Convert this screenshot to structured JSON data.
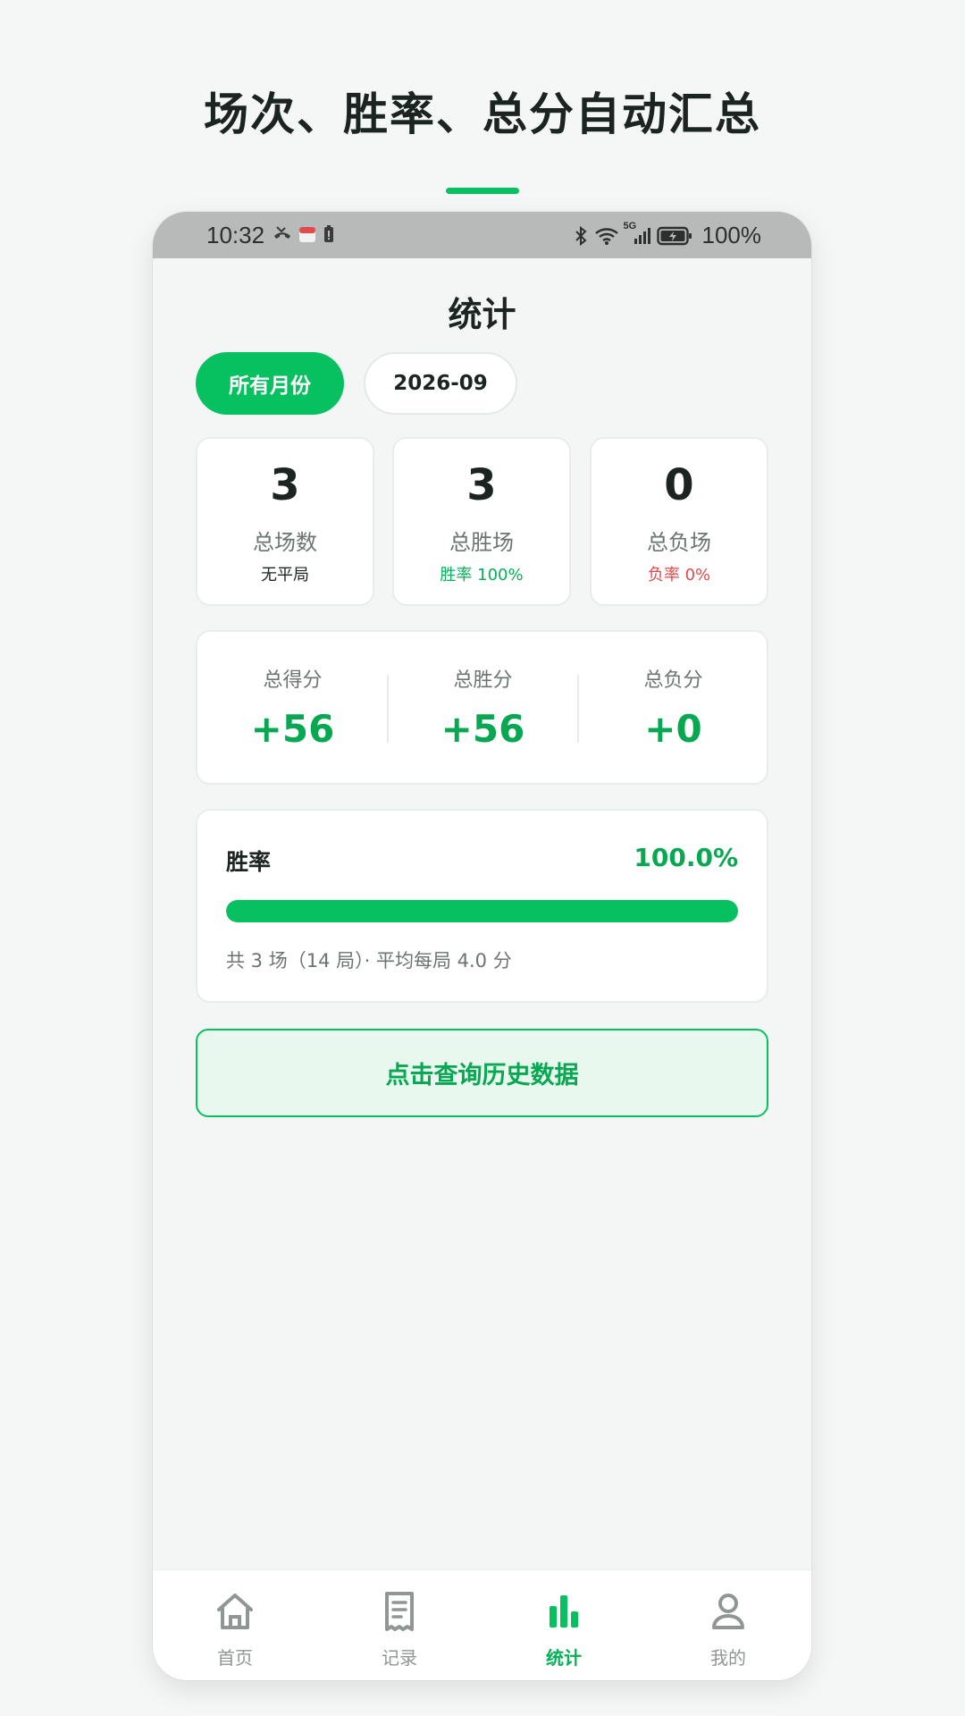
{
  "headline": "场次、胜率、总分自动汇总",
  "status_bar": {
    "time": "10:32",
    "signal_label": "5G",
    "battery": "100%"
  },
  "page": {
    "title": "统计"
  },
  "filters": {
    "all_months": "所有月份",
    "month": "2026-09"
  },
  "summary": {
    "total": {
      "value": "3",
      "label": "总场数",
      "sub": "无平局"
    },
    "wins": {
      "value": "3",
      "label": "总胜场",
      "sub": "胜率 100%"
    },
    "losses": {
      "value": "0",
      "label": "总负场",
      "sub": "负率 0%"
    }
  },
  "scores": {
    "total": {
      "label": "总得分",
      "value": "+56"
    },
    "win": {
      "label": "总胜分",
      "value": "+56"
    },
    "loss": {
      "label": "总负分",
      "value": "+0"
    }
  },
  "win_rate": {
    "label": "胜率",
    "value": "100.0%",
    "progress": 1.0,
    "note": "共 3 场（14 局）· 平均每局 4.0 分"
  },
  "history_button": "点击查询历史数据",
  "tabs": [
    {
      "label": "首页",
      "icon": "home-icon"
    },
    {
      "label": "记录",
      "icon": "receipt-icon"
    },
    {
      "label": "统计",
      "icon": "bar-chart-icon"
    },
    {
      "label": "我的",
      "icon": "user-icon"
    }
  ],
  "colors": {
    "accent": "#07c160",
    "accent_text": "#07a851",
    "loss_red": "#e5484d",
    "muted": "#8f9693"
  }
}
